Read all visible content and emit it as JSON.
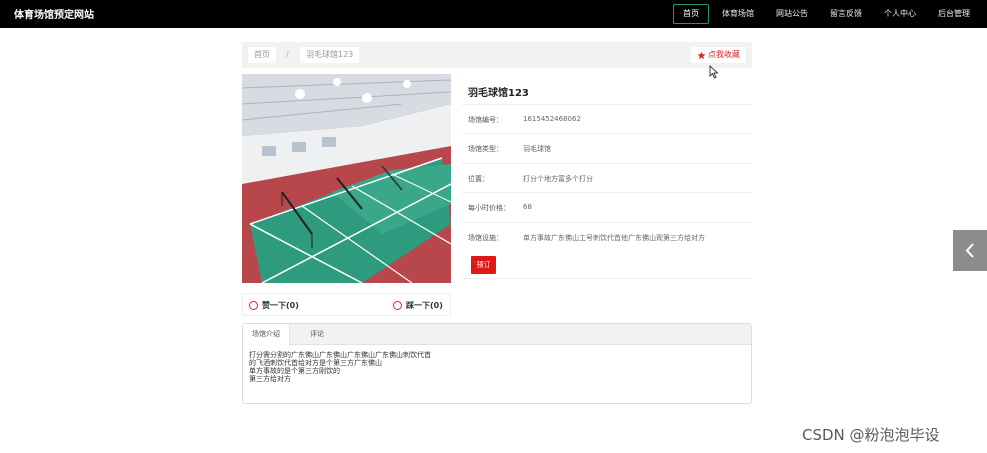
{
  "header": {
    "site_title": "体育场馆预定网站",
    "nav": [
      {
        "label": "首页",
        "active": true
      },
      {
        "label": "体育场馆",
        "active": false
      },
      {
        "label": "网站公告",
        "active": false
      },
      {
        "label": "留言反馈",
        "active": false
      },
      {
        "label": "个人中心",
        "active": false
      },
      {
        "label": "后台管理",
        "active": false
      }
    ]
  },
  "breadcrumb": {
    "home": "首页",
    "separator": "/",
    "current": "羽毛球馆123"
  },
  "favorite": {
    "icon": "star-icon",
    "label": "点我收藏"
  },
  "venue": {
    "title": "羽毛球馆123",
    "fields": [
      {
        "label": "场馆编号：",
        "value": "1615452468062"
      },
      {
        "label": "场馆类型：",
        "value": "羽毛球馆"
      },
      {
        "label": "位置：",
        "value": "打分个地方富多个打分"
      },
      {
        "label": "每小时价格：",
        "value": "68"
      },
      {
        "label": "场馆设施：",
        "value": "单方事故广东佛山工号刺饮代首他广东佛山观第三方给对方"
      }
    ],
    "book_label": "预订"
  },
  "votes": {
    "like_label": "赞一下(0)",
    "dislike_label": "踩一下(0)"
  },
  "tabs": {
    "items": [
      "场馆介绍",
      "评论"
    ],
    "active_index": 0,
    "intro_lines": [
      "打分需分割的广东佛山广东佛山广东佛山广东佛山刺饮代首",
      "的飞洒刺饮代首给对方是个第三方广东佛山",
      "单方事故的是个第三方刚饮的",
      "第三方给对方"
    ]
  },
  "watermark": "CSDN @粉泡泡毕设",
  "colors": {
    "topbar": "#000000",
    "accent_red": "#e01818",
    "nav_active_border": "#1a9a7a",
    "court_green": "#2e9b7e",
    "court_red": "#b8474c"
  }
}
